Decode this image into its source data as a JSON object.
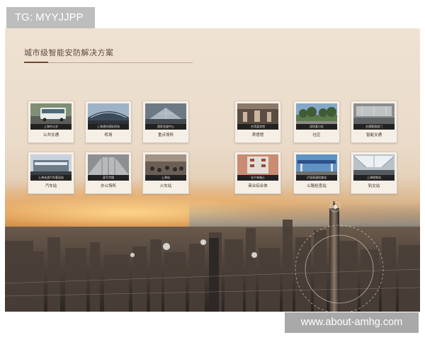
{
  "watermark": {
    "top_left": "TG: MYYJJPP",
    "bottom_right": "www.about-amhg.com"
  },
  "slide": {
    "heading": "城市级智能安防解决方案",
    "left_group": [
      {
        "caption": "上海市公交",
        "label": "公共交通",
        "icon": "bus-photo"
      },
      {
        "caption": "上海浦东国际机场",
        "label": "机场",
        "icon": "airport-photo"
      },
      {
        "caption": "国家会展中心",
        "label": "重点场所",
        "icon": "exhibition-photo"
      },
      {
        "caption": "上海长途汽车客运站",
        "label": "汽车站",
        "icon": "coach-station-photo"
      },
      {
        "caption": "某写字楼",
        "label": "办公场所",
        "icon": "office-photo"
      },
      {
        "caption": "上海站",
        "label": "火车站",
        "icon": "train-station-photo"
      }
    ],
    "right_group": [
      {
        "caption": "台湾某宾馆",
        "label": "宾馆馆",
        "icon": "hotel-photo"
      },
      {
        "caption": "深圳某小区",
        "label": "社区",
        "icon": "community-photo"
      },
      {
        "caption": "交通管理部门",
        "label": "智能交通",
        "icon": "traffic-photo"
      },
      {
        "caption": "长宁来福士",
        "label": "商业综合体",
        "icon": "mall-photo"
      },
      {
        "caption": "沪昆高速检查站",
        "label": "公路检查站",
        "icon": "checkpoint-photo"
      },
      {
        "caption": "上海地铁站",
        "label": "轨交站",
        "icon": "metro-photo"
      }
    ]
  }
}
